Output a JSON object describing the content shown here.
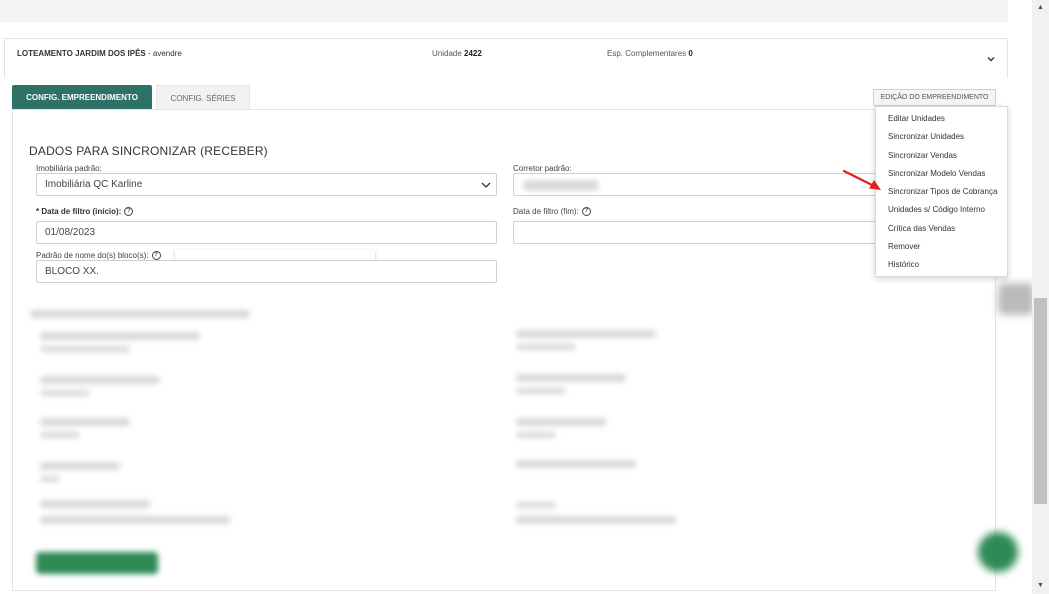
{
  "header": {
    "title": "LOTEAMENTO JARDIM DOS IPÊS",
    "title_suffix": " - avendre",
    "unit_label": "Unidade ",
    "unit_value": "2422",
    "esp_label": "Esp. Complementares ",
    "esp_value": "0"
  },
  "tabs": [
    {
      "label": "CONFIG. EMPREENDIMENTO"
    },
    {
      "label": "CONFIG. SÉRIES"
    }
  ],
  "edit_button": "EDIÇÃO DO EMPREENDIMENTO",
  "form": {
    "section_title": "DADOS PARA SINCRONIZAR (RECEBER)",
    "imobiliaria_label": "Imobiliária padrão:",
    "imobiliaria_value": "Imobiliária QC Karline",
    "corretor_label": "Corretor padrão:",
    "data_inicio_label": "Data de filtro (início):",
    "data_inicio_value": "01/08/2023",
    "data_fim_label": "Data de filtro (fim):",
    "padrao_bloco_label": "Padrão de nome do(s) bloco(s):",
    "padrao_bloco_value": "BLOCO XX."
  },
  "menu": {
    "items": [
      {
        "label": "Editar Unidades"
      },
      {
        "label": "Sincronizar Unidades"
      },
      {
        "label": "Sincronizar Vendas"
      },
      {
        "label": "Sincronizar Modelo Vendas"
      },
      {
        "label": "Sincronizar Tipos de Cobrança"
      },
      {
        "label": "Unidades s/ Código Interno"
      },
      {
        "label": "Crítica das Vendas"
      },
      {
        "label": "Remover"
      },
      {
        "label": "Histórico"
      }
    ]
  },
  "colors": {
    "accent": "#2e7166",
    "arrow": "#e02020"
  }
}
